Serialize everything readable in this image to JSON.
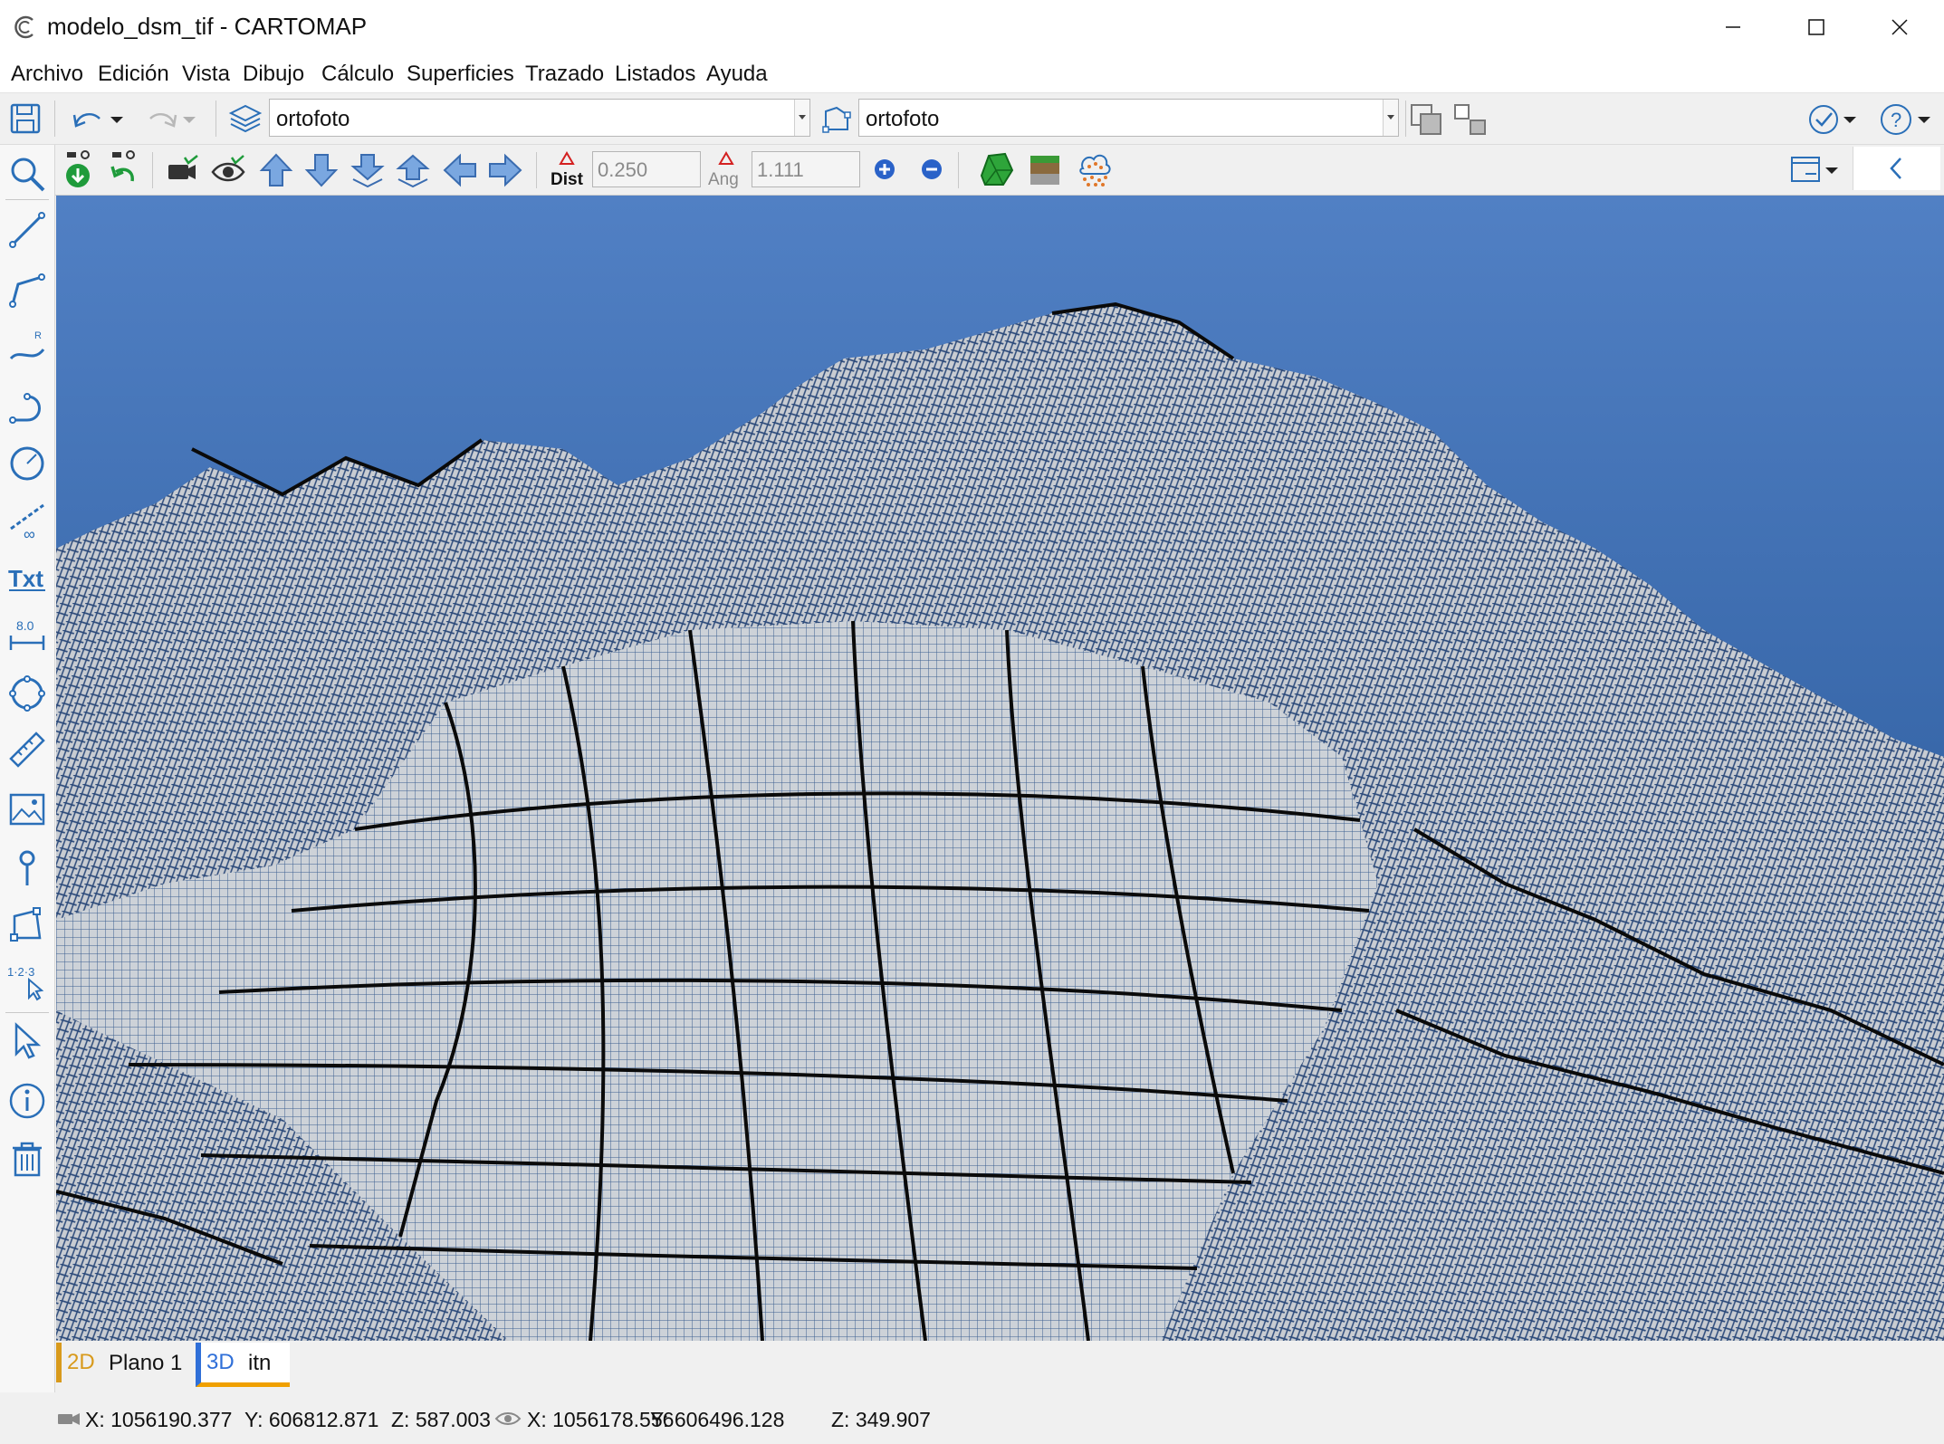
{
  "window": {
    "title": "modelo_dsm_tif - CARTOMAP",
    "controls": [
      "minimize",
      "maximize",
      "close"
    ]
  },
  "menu": [
    "Archivo",
    "Edición",
    "Vista",
    "Dibujo",
    "Cálculo",
    "Superficies",
    "Trazado",
    "Listados",
    "Ayuda"
  ],
  "toolbar_top": {
    "layer_combo": "ortofoto",
    "layer_combo_2": "ortofoto"
  },
  "toolbar_view": {
    "dist_label": "Dist",
    "dist_value": "0.250",
    "ang_label": "Ang",
    "ang_value": "1.111"
  },
  "tabs": [
    {
      "prefix": "2D",
      "label": "Plano 1",
      "color": "#d89a1c"
    },
    {
      "prefix": "3D",
      "label": "itn",
      "color": "#2f6fd8"
    }
  ],
  "status": {
    "camera_x": "X: 1056190.377",
    "camera_y": "Y: 606812.871",
    "camera_z": "Z: 587.003",
    "target_x": "X: 1056178.556",
    "target_y": "Y: 606496.128",
    "target_z": "Z: 349.907"
  },
  "colors": {
    "sky_top": "#5180c4",
    "sky_bottom": "#1f4f8f",
    "terrain": "#cdd2d8",
    "grid": "#111111",
    "accent": "#2a7ad8"
  }
}
